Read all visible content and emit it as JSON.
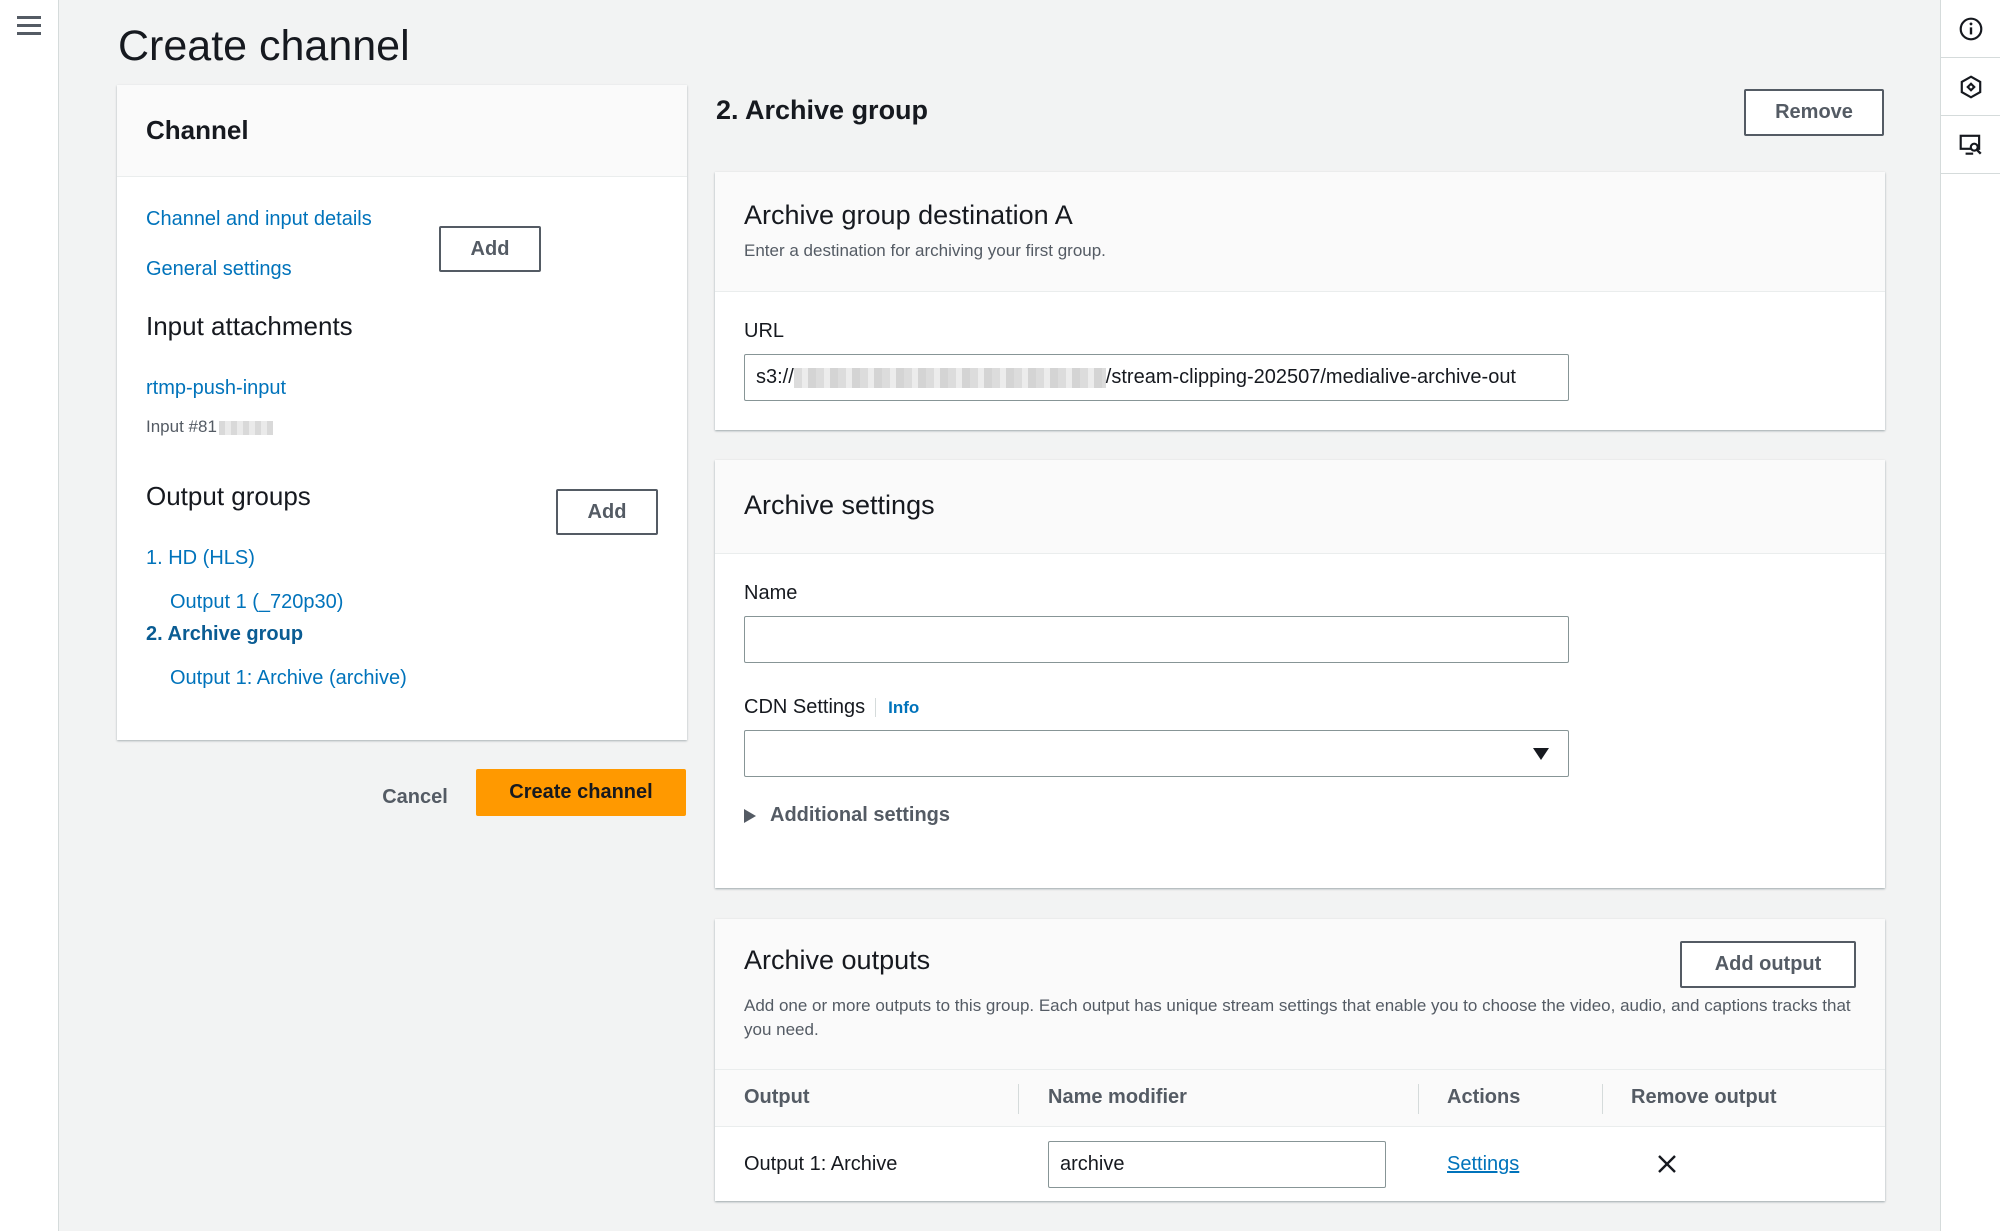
{
  "page": {
    "title": "Create channel"
  },
  "nav": {
    "header": "Channel",
    "links": {
      "channel_input_details": "Channel and input details",
      "general_settings": "General settings"
    },
    "input_attachments": {
      "title": "Input attachments",
      "add_label": "Add",
      "input_name": "rtmp-push-input",
      "input_id_prefix": "Input #81"
    },
    "output_groups": {
      "title": "Output groups",
      "add_label": "Add",
      "items": [
        {
          "label": "1. HD (HLS)"
        },
        {
          "label": "Output 1 (_720p30)"
        },
        {
          "label": "2. Archive group"
        },
        {
          "label": "Output 1: Archive (archive)"
        }
      ]
    }
  },
  "actions": {
    "cancel": "Cancel",
    "create": "Create channel"
  },
  "archive_group": {
    "title": "2. Archive group",
    "remove_label": "Remove",
    "destination": {
      "title": "Archive group destination A",
      "description": "Enter a destination for archiving your first group.",
      "url_label": "URL",
      "url_prefix": "s3://",
      "url_suffix": "/stream-clipping-202507/medialive-archive-out"
    },
    "settings": {
      "title": "Archive settings",
      "name_label": "Name",
      "name_value": "",
      "cdn_label": "CDN Settings",
      "info_label": "Info",
      "cdn_value": "",
      "additional_label": "Additional settings"
    },
    "outputs": {
      "title": "Archive outputs",
      "add_label": "Add output",
      "description": "Add one or more outputs to this group. Each output has unique stream settings that enable you to choose the video, audio, and captions tracks that you need.",
      "columns": [
        "Output",
        "Name modifier",
        "Actions",
        "Remove output"
      ],
      "rows": [
        {
          "output": "Output 1: Archive",
          "name_modifier": "archive",
          "action": "Settings"
        }
      ]
    }
  },
  "colors": {
    "link": "#0073bb",
    "primary_button": "#ff9900",
    "border": "#879596"
  }
}
